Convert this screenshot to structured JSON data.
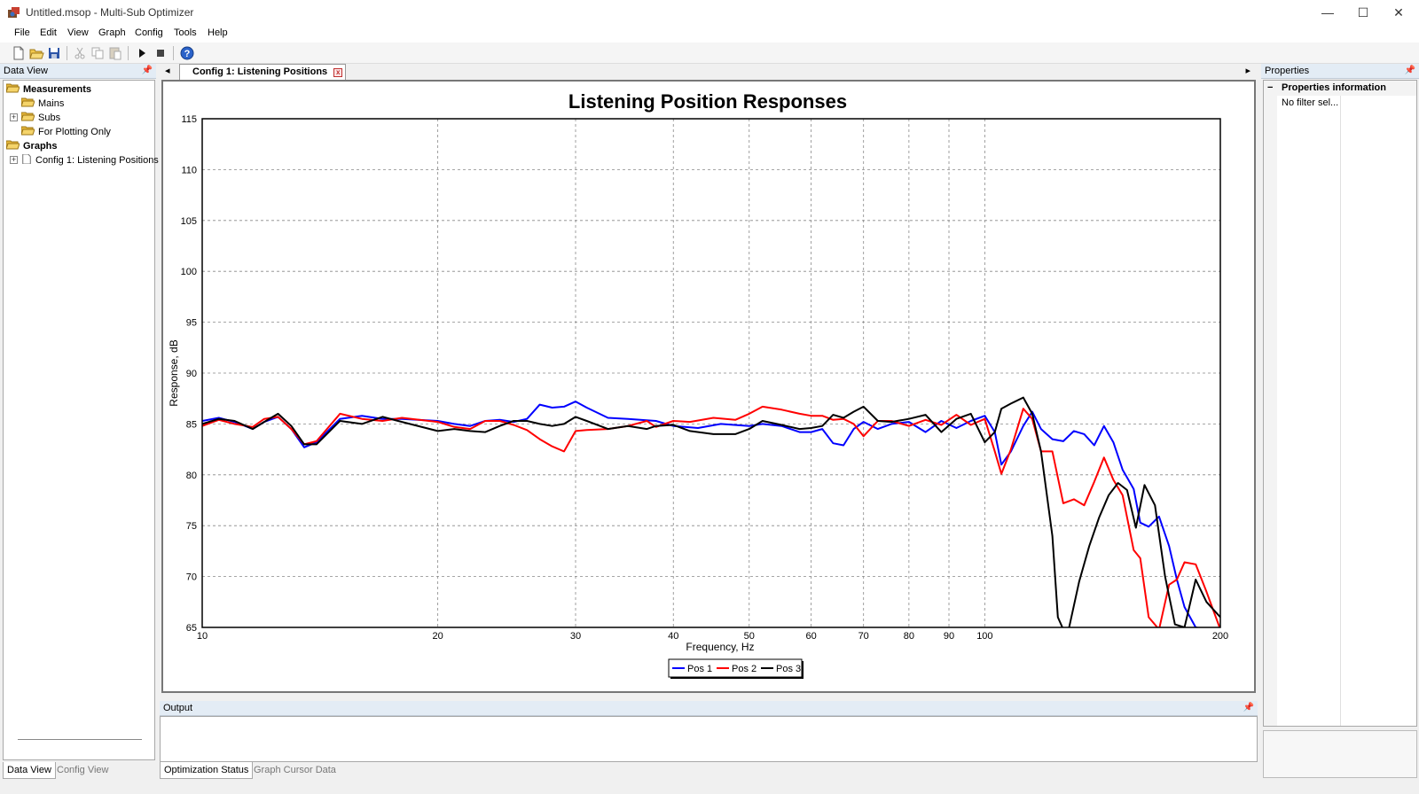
{
  "window": {
    "title": "Untitled.msop - Multi-Sub Optimizer",
    "min_glyph": "—",
    "max_glyph": "☐",
    "close_glyph": "✕"
  },
  "menu": [
    "File",
    "Edit",
    "View",
    "Graph",
    "Config",
    "Tools",
    "Help"
  ],
  "toolbar": {
    "icons": [
      "new-file-icon",
      "open-folder-icon",
      "save-icon",
      "cut-icon",
      "copy-icon",
      "paste-icon",
      "play-icon",
      "stop-icon",
      "help-icon"
    ]
  },
  "data_view": {
    "title": "Data View",
    "pin": "📌",
    "tree": [
      {
        "label": "Measurements",
        "bold": true,
        "icon": "folder-open-icon"
      },
      {
        "label": "Mains",
        "bold": false,
        "icon": "folder-icon"
      },
      {
        "label": "Subs",
        "bold": false,
        "icon": "folder-icon",
        "expander": "+"
      },
      {
        "label": "For Plotting Only",
        "bold": false,
        "icon": "folder-icon"
      },
      {
        "label": "Graphs",
        "bold": true,
        "icon": "folder-open-icon"
      },
      {
        "label": "Config 1: Listening Positions",
        "bold": false,
        "icon": "document-icon",
        "expander": "+"
      }
    ],
    "tabs": [
      "Data View",
      "Config View"
    ]
  },
  "document": {
    "tab_label": "Config 1: Listening Positions",
    "nav_left": "◂",
    "nav_right": "▸",
    "close_glyph": "x"
  },
  "output": {
    "title": "Output",
    "tabs": [
      "Optimization Status",
      "Graph Cursor Data"
    ]
  },
  "properties": {
    "title": "Properties",
    "section_label": "Properties information",
    "section_expander": "−",
    "value": "No filter sel..."
  },
  "colors": {
    "pos1": "#0000ff",
    "pos2": "#ff0000",
    "pos3": "#000000",
    "grid": "#888888"
  },
  "chart_data": {
    "type": "line",
    "title": "Listening Position Responses",
    "xlabel": "Frequency, Hz",
    "ylabel": "Response, dB",
    "xscale": "log",
    "xlim": [
      10,
      200
    ],
    "ylim": [
      65,
      115
    ],
    "xticks": [
      10,
      20,
      30,
      40,
      50,
      60,
      70,
      80,
      90,
      100,
      200
    ],
    "yticks": [
      65,
      70,
      75,
      80,
      85,
      90,
      95,
      100,
      105,
      110,
      115
    ],
    "grid": true,
    "legend_position": "bottom-center",
    "series": [
      {
        "name": "Pos 1",
        "color": "#0000ff",
        "x": [
          10,
          10.5,
          11,
          11.6,
          12,
          12.5,
          13,
          13.5,
          14,
          15,
          16,
          17,
          18,
          20,
          21,
          22,
          23,
          24,
          25,
          26,
          27,
          28,
          29,
          30,
          31,
          33,
          35,
          38,
          40,
          43,
          46,
          50,
          52,
          55,
          58,
          60,
          62,
          64,
          66,
          68,
          70,
          73,
          76,
          80,
          84,
          88,
          92,
          96,
          100,
          103,
          105,
          108,
          112,
          115,
          118,
          122,
          126,
          130,
          134,
          138,
          142,
          146,
          150,
          155,
          158,
          162,
          167,
          172,
          176,
          180,
          186,
          192,
          200
        ],
        "y": [
          85.3,
          85.6,
          85.2,
          84.5,
          85.2,
          85.7,
          84.5,
          82.7,
          83.2,
          85.5,
          85.8,
          85.5,
          85.5,
          85.3,
          85.0,
          84.8,
          85.3,
          85.4,
          85.2,
          85.5,
          86.9,
          86.6,
          86.7,
          87.2,
          86.6,
          85.6,
          85.5,
          85.3,
          84.8,
          84.6,
          85.0,
          84.8,
          85.0,
          84.8,
          84.2,
          84.2,
          84.5,
          83.1,
          82.9,
          84.5,
          85.2,
          84.5,
          85.0,
          85.2,
          84.2,
          85.3,
          84.6,
          85.3,
          85.8,
          84.2,
          81.0,
          82.3,
          84.8,
          86.2,
          84.5,
          83.5,
          83.3,
          84.3,
          84.0,
          82.9,
          84.8,
          83.2,
          80.5,
          78.6,
          75.3,
          74.9,
          75.9,
          73.0,
          69.7,
          67.0,
          65.0,
          64.8,
          64.8
        ]
      },
      {
        "name": "Pos 2",
        "color": "#ff0000",
        "x": [
          10,
          10.5,
          11,
          11.6,
          12,
          12.5,
          13,
          13.5,
          14,
          15,
          16,
          17,
          18,
          20,
          21,
          22,
          23,
          24,
          25,
          26,
          27,
          28,
          29,
          30,
          31,
          33,
          35,
          37,
          38,
          40,
          42,
          45,
          48,
          50,
          52,
          55,
          58,
          60,
          62,
          64,
          66,
          68,
          70,
          73,
          76,
          80,
          84,
          88,
          92,
          96,
          100,
          103,
          105,
          108,
          112,
          115,
          118,
          122,
          126,
          130,
          134,
          138,
          142,
          146,
          150,
          155,
          158,
          162,
          167,
          172,
          176,
          180,
          186,
          192,
          200
        ],
        "y": [
          84.8,
          85.4,
          85.0,
          84.7,
          85.5,
          85.7,
          84.5,
          83.0,
          83.3,
          86.0,
          85.5,
          85.3,
          85.6,
          85.2,
          84.7,
          84.5,
          85.3,
          85.3,
          84.9,
          84.4,
          83.5,
          82.8,
          82.3,
          84.3,
          84.4,
          84.5,
          84.8,
          85.3,
          84.7,
          85.3,
          85.2,
          85.6,
          85.4,
          86.0,
          86.7,
          86.4,
          86.0,
          85.8,
          85.8,
          85.4,
          85.5,
          85.0,
          83.8,
          85.3,
          85.3,
          84.8,
          85.4,
          84.9,
          85.9,
          84.9,
          85.5,
          82.3,
          80.1,
          82.5,
          86.5,
          85.5,
          82.3,
          82.3,
          77.2,
          77.6,
          77.0,
          79.3,
          81.7,
          79.5,
          78.0,
          72.6,
          71.8,
          66.0,
          64.8,
          69.2,
          69.7,
          71.4,
          71.2,
          68.5,
          64.8
        ]
      },
      {
        "name": "Pos 3",
        "color": "#000000",
        "x": [
          10,
          10.5,
          11,
          11.6,
          12,
          12.5,
          13,
          13.5,
          14,
          15,
          16,
          17,
          18,
          20,
          21,
          22,
          23,
          24,
          25,
          26,
          27,
          28,
          29,
          30,
          31,
          33,
          35,
          37,
          38,
          40,
          42,
          45,
          48,
          50,
          52,
          55,
          58,
          60,
          62,
          64,
          66,
          68,
          70,
          73,
          76,
          80,
          84,
          88,
          92,
          96,
          100,
          103,
          105,
          108,
          112,
          115,
          118,
          122,
          124,
          126,
          128,
          132,
          136,
          140,
          144,
          148,
          152,
          156,
          160,
          165,
          170,
          175,
          180,
          186,
          192,
          200
        ],
        "y": [
          85.0,
          85.5,
          85.3,
          84.5,
          85.2,
          86.0,
          84.8,
          83.0,
          83.0,
          85.3,
          85.0,
          85.7,
          85.2,
          84.3,
          84.5,
          84.3,
          84.2,
          84.8,
          85.3,
          85.3,
          85.0,
          84.8,
          85.0,
          85.7,
          85.3,
          84.5,
          84.8,
          84.5,
          84.8,
          84.9,
          84.3,
          84.0,
          84.0,
          84.5,
          85.3,
          84.9,
          84.5,
          84.6,
          84.8,
          85.9,
          85.6,
          86.2,
          86.7,
          85.3,
          85.2,
          85.5,
          85.9,
          84.2,
          85.5,
          86.0,
          83.2,
          84.2,
          86.5,
          87.0,
          87.6,
          86.0,
          82.3,
          74.0,
          66.0,
          64.8,
          64.8,
          69.5,
          73.0,
          75.8,
          78.0,
          79.2,
          78.5,
          74.8,
          79.0,
          77.0,
          70.0,
          65.3,
          65.0,
          69.7,
          67.5,
          66.0
        ]
      }
    ]
  }
}
